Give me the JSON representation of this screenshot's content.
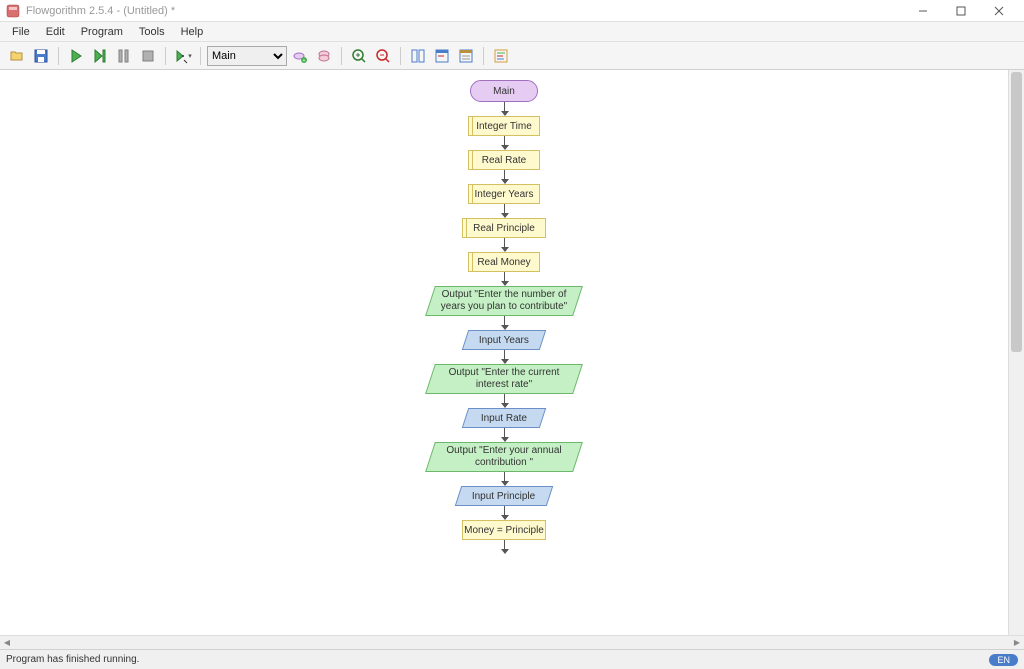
{
  "window": {
    "title": "Flowgorithm 2.5.4 - (Untitled) *"
  },
  "menu": {
    "file": "File",
    "edit": "Edit",
    "program": "Program",
    "tools": "Tools",
    "help": "Help"
  },
  "toolbar": {
    "function_selected": "Main"
  },
  "flow": {
    "main": "Main",
    "n1": "Integer Time",
    "n2": "Real Rate",
    "n3": "Integer Years",
    "n4": "Real Principle",
    "n5": "Real Money",
    "n6": "Output \"Enter the number of years you plan to contribute\"",
    "n7": "Input Years",
    "n8": "Output \"Enter the current interest rate\"",
    "n9": "Input Rate",
    "n10": "Output \"Enter your annual contribution \"",
    "n11": "Input Principle",
    "n12": "Money = Principle"
  },
  "status": {
    "text": "Program has finished running.",
    "lang": "EN"
  }
}
